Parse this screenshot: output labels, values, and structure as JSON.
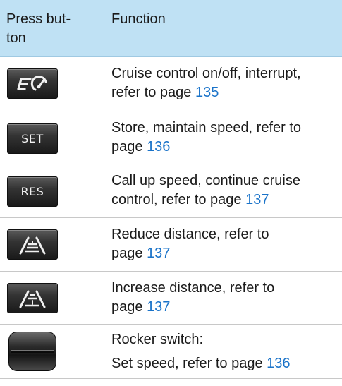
{
  "header": {
    "col1": "Press but-\nton",
    "col1_line1": "Press but-",
    "col1_line2": "ton",
    "col2": "Function"
  },
  "rows": [
    {
      "icon": "cruise-control-icon",
      "text": "Cruise control on/off, interrupt, refer to page ",
      "text_lines": [
        "Cruise control on/off, interrupt,",
        "refer to page "
      ],
      "page": "135"
    },
    {
      "button_label": "SET",
      "text_lines": [
        "Store, maintain speed, refer to",
        "page "
      ],
      "page": "136"
    },
    {
      "button_label": "RES",
      "text_lines": [
        "Call up speed, continue cruise",
        "control, refer to page "
      ],
      "page": "137"
    },
    {
      "icon": "reduce-distance-icon",
      "text_lines": [
        "Reduce distance, refer to",
        "page "
      ],
      "page": "137"
    },
    {
      "icon": "increase-distance-icon",
      "text_lines": [
        "Increase distance, refer to",
        "page "
      ],
      "page": "137"
    },
    {
      "icon": "rocker-switch-icon",
      "text_lines": [
        "Rocker switch:",
        "Set speed, refer to page "
      ],
      "page": "136"
    }
  ],
  "colors": {
    "header_bg": "#bfe1f4",
    "link": "#1a73c9",
    "rule": "#c8c8c8"
  }
}
